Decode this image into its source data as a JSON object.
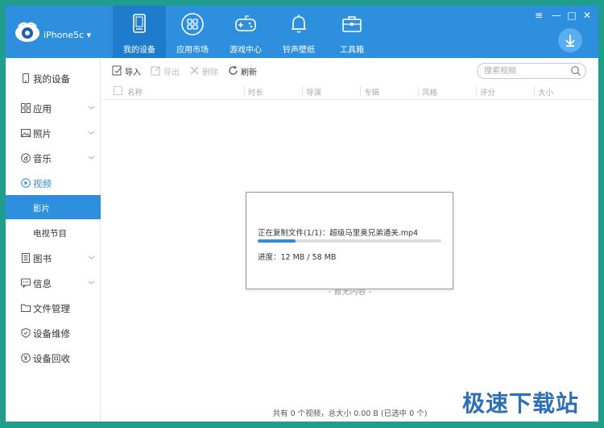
{
  "app": {
    "device_name": "iPhone5c ▾"
  },
  "nav": {
    "tabs": [
      {
        "label": "我的设备",
        "icon": "tablet-icon"
      },
      {
        "label": "应用市场",
        "icon": "app-grid-icon"
      },
      {
        "label": "游戏中心",
        "icon": "gamepad-icon"
      },
      {
        "label": "铃声壁纸",
        "icon": "bell-icon"
      },
      {
        "label": "工具箱",
        "icon": "toolbox-icon"
      }
    ],
    "active_index": 0
  },
  "window_controls": {
    "menu": "≡",
    "minimize": "—",
    "maximize": "□",
    "close": "✕"
  },
  "sidebar": {
    "items": [
      {
        "label": "我的设备",
        "icon": "phone-icon"
      },
      {
        "label": "应用",
        "icon": "grid-icon"
      },
      {
        "label": "照片",
        "icon": "image-icon"
      },
      {
        "label": "音乐",
        "icon": "music-icon"
      },
      {
        "label": "视频",
        "icon": "play-icon"
      },
      {
        "label": "影片",
        "icon": ""
      },
      {
        "label": "电视节目",
        "icon": ""
      },
      {
        "label": "图书",
        "icon": "book-icon"
      },
      {
        "label": "信息",
        "icon": "message-icon"
      },
      {
        "label": "文件管理",
        "icon": "folder-icon"
      },
      {
        "label": "设备维修",
        "icon": "repair-icon"
      },
      {
        "label": "设备回收",
        "icon": "recycle-icon"
      }
    ]
  },
  "toolbar": {
    "import": "导入",
    "export": "导出",
    "delete": "删除",
    "refresh": "刷新"
  },
  "search": {
    "placeholder": "搜索视频"
  },
  "table": {
    "columns": [
      "名称",
      "时长",
      "导演",
      "专辑",
      "风格",
      "评分",
      "大小"
    ]
  },
  "empty_text": "- 暂无内容 -",
  "dialog": {
    "copy_text": "正在复制文件(1/1)：超级马里奥兄弟通关.mp4",
    "progress_text": "进度：12 MB / 58 MB",
    "progress_fraction": 0.207
  },
  "status": "共有 0 个视频，总大小 0.00 B (已选中 0 个)",
  "watermark": "极速下载站",
  "colors": {
    "accent": "#2d8fde",
    "accent_dark": "#1f7ccd",
    "frame": "#1f9e8c"
  }
}
